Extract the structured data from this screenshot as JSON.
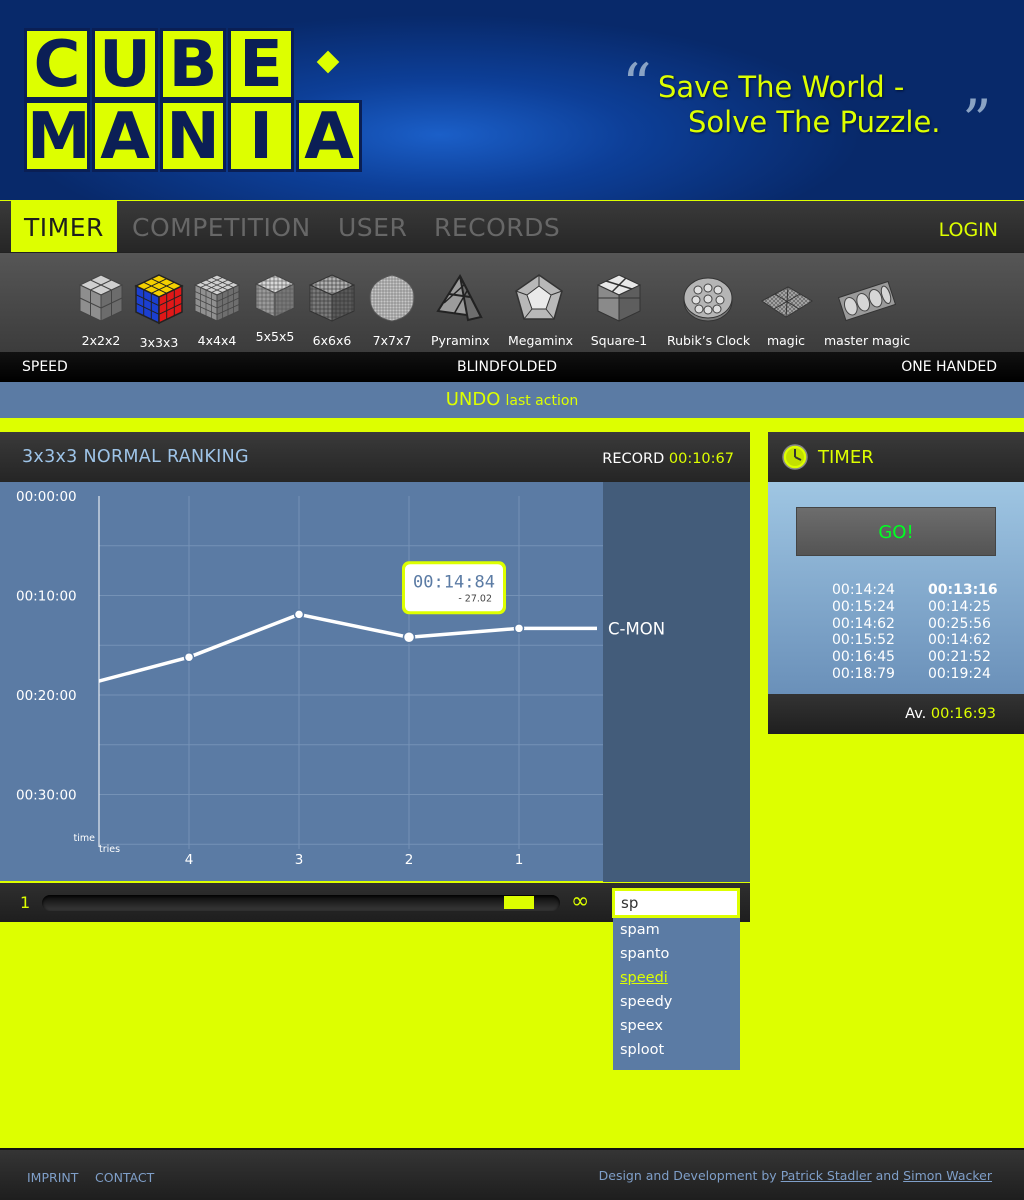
{
  "logo": {
    "row1": [
      "C",
      "U",
      "B",
      "E"
    ],
    "row2": [
      "M",
      "A",
      "N",
      "I",
      "A"
    ]
  },
  "slogan": {
    "open_quote": "“",
    "line1": "Save The World -",
    "line2": "Solve The Puzzle.",
    "close_quote": "”"
  },
  "nav": {
    "items": [
      {
        "label": "TIMER",
        "active": true
      },
      {
        "label": "COMPETITION",
        "active": false
      },
      {
        "label": "USER",
        "active": false
      },
      {
        "label": "RECORDS",
        "active": false
      }
    ],
    "login": "LOGIN"
  },
  "puzzles": [
    {
      "label": "2x2x2",
      "icon": "cube-2x2-icon"
    },
    {
      "label": "3x3x3",
      "icon": "cube-3x3-icon"
    },
    {
      "label": "4x4x4",
      "icon": "cube-4x4-icon"
    },
    {
      "label": "5x5x5",
      "icon": "cube-5x5-icon"
    },
    {
      "label": "6x6x6",
      "icon": "cube-6x6-icon"
    },
    {
      "label": "7x7x7",
      "icon": "cube-7x7-icon"
    },
    {
      "label": "Pyraminx",
      "icon": "pyraminx-icon"
    },
    {
      "label": "Megaminx",
      "icon": "megaminx-icon"
    },
    {
      "label": "Square-1",
      "icon": "square1-icon"
    },
    {
      "label": "Rubik’s Clock",
      "icon": "rubiks-clock-icon"
    },
    {
      "label": "magic",
      "icon": "magic-icon"
    },
    {
      "label": "master magic",
      "icon": "master-magic-icon"
    }
  ],
  "categories": {
    "left": "SPEED",
    "center": "BLINDFOLDED",
    "right": "ONE HANDED"
  },
  "undo": {
    "word": "UNDO",
    "rest": "last action"
  },
  "ranking": {
    "title": "3x3x3 NORMAL RANKING",
    "record_label": "RECORD",
    "record_value": "00:10:67"
  },
  "chart_data": {
    "type": "line",
    "x_label": "tries",
    "y_label": "time",
    "x_ticks": [
      "4",
      "3",
      "2",
      "1"
    ],
    "y_ticks": [
      "00:00:00",
      "00:10:00",
      "00:20:00",
      "00:30:00"
    ],
    "y_inverted": true,
    "ylim": [
      0,
      35
    ],
    "series": [
      {
        "name": "C-MON",
        "x": [
          5,
          4,
          3,
          2,
          1,
          0
        ],
        "y": [
          18.6,
          16.2,
          11.9,
          14.2,
          13.3,
          13.3
        ]
      }
    ],
    "tooltip": {
      "value": "00:14:84",
      "delta": "- 27.02"
    },
    "grid": true
  },
  "slider": {
    "min_label": "1",
    "max_label": "∞",
    "value_fraction": 0.95
  },
  "search": {
    "value": "sp",
    "suggestions": [
      "spam",
      "spanto",
      "speedi",
      "speedy",
      "speex",
      "sploot"
    ],
    "highlighted": "speedi"
  },
  "timer": {
    "title": "TIMER",
    "go_label": "GO!",
    "col1": [
      "00:14:24",
      "00:15:24",
      "00:14:62",
      "00:15:52",
      "00:16:45",
      "00:18:79"
    ],
    "col2": [
      "00:13:16",
      "00:14:25",
      "00:25:56",
      "00:14:62",
      "00:21:52",
      "00:19:24"
    ],
    "best": "00:13:16",
    "avg_label": "Av.",
    "avg_value": "00:16:93"
  },
  "footer": {
    "imprint": "IMPRINT",
    "contact": "CONTACT",
    "credit_prefix": "Design and Development by",
    "author1": "Patrick Stadler",
    "and": "and",
    "author2": "Simon Wacker"
  },
  "colors": {
    "accent": "#ddff00",
    "header_blue": "#0d3f98",
    "panel_blue": "#5b7ba4",
    "dark": "#262626",
    "go_green": "#00ff22"
  }
}
